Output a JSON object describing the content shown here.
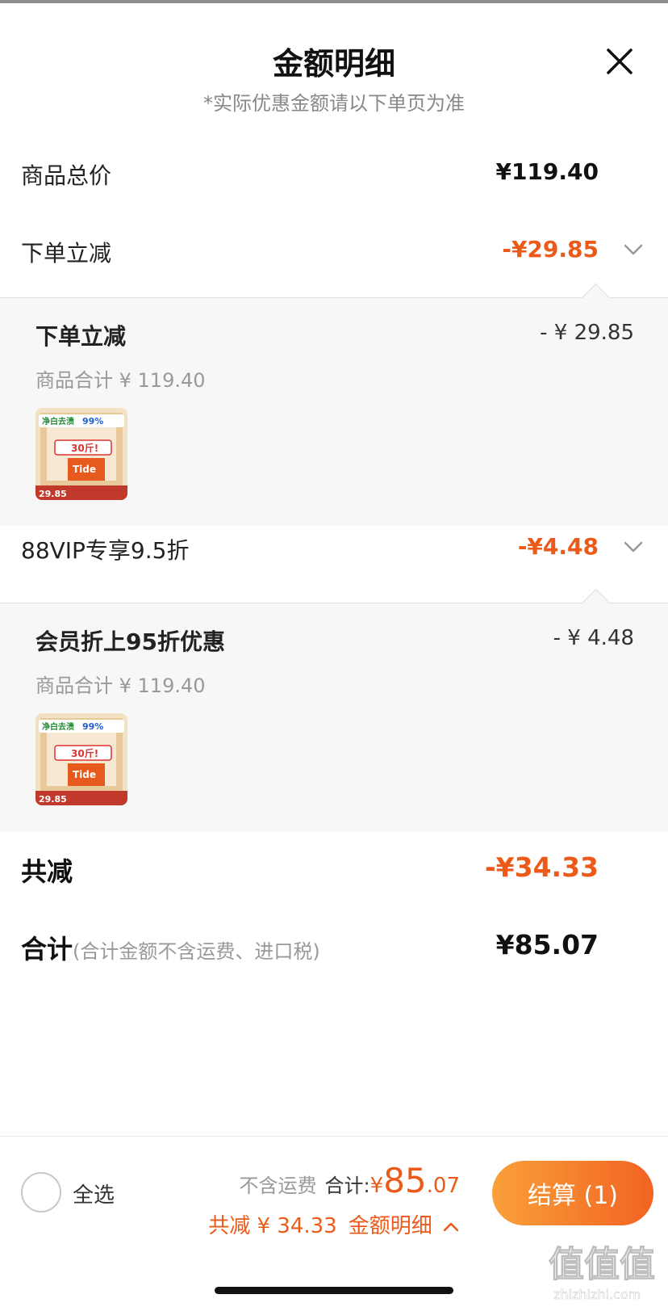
{
  "header": {
    "title": "金额明细",
    "subtitle": "*实际优惠金额请以下单页为准"
  },
  "summary": {
    "goods_total_label": "商品总价",
    "goods_total_value": "¥119.40",
    "discount1_label": "下单立减",
    "discount1_value": "-¥29.85",
    "discount2_label": "88VIP专享9.5折",
    "discount2_value": "-¥4.48"
  },
  "panel1": {
    "title": "下单立减",
    "amount": "- ¥ 29.85",
    "subtotal": "商品合计 ¥ 119.40",
    "thumb": {
      "top_banner": "净白去渍",
      "highlight": "99%",
      "badge": "30斤!",
      "brand": "Tide",
      "price": "29.85"
    }
  },
  "panel2": {
    "title": "会员折上95折优惠",
    "amount": "- ¥ 4.48",
    "subtotal": "商品合计 ¥ 119.40",
    "thumb": {
      "top_banner": "净白去渍",
      "highlight": "99%",
      "badge": "30斤!",
      "brand": "Tide",
      "price": "29.85"
    }
  },
  "totals": {
    "total_discount_label": "共减",
    "total_discount_value": "-¥34.33",
    "grand_total_label": "合计",
    "grand_total_note": "(合计金额不含运费、进口税)",
    "grand_total_value": "¥85.07"
  },
  "footer": {
    "select_all": "全选",
    "shipping_note": "不含运费",
    "total_label": "合计:",
    "currency": "¥",
    "amount_int": "85",
    "amount_dec": ".07",
    "saved_text": "共减 ¥ 34.33",
    "detail_link": "金额明细",
    "checkout_label": "结算 (1)"
  },
  "watermark": {
    "logo": "值值值",
    "site": "zhizhizhi.com"
  },
  "colors": {
    "accent": "#ec5a1a",
    "checkout_gradient_start": "#f9a03a",
    "checkout_gradient_end": "#f26322",
    "panel_bg": "#f7f7f7",
    "muted_text": "#999999"
  },
  "icons": {
    "close": "close-icon",
    "chevron": "chevron-down-icon",
    "chevron_up": "chevron-up-icon"
  }
}
